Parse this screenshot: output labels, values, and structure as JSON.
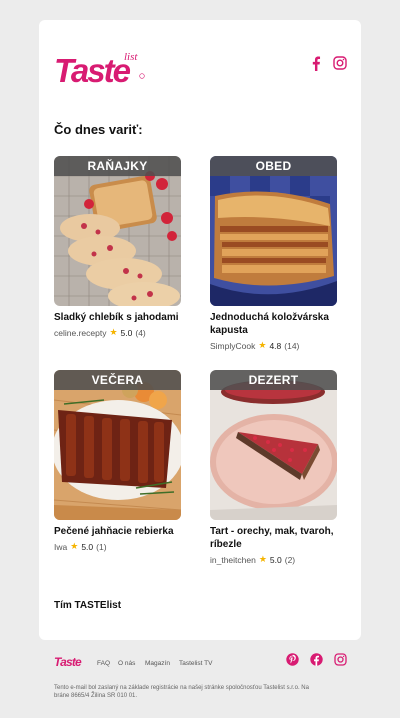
{
  "brand": {
    "name": "Taste",
    "suffix": "list",
    "color": "#d81b72"
  },
  "header": {
    "social": [
      "facebook-icon",
      "instagram-icon"
    ]
  },
  "main": {
    "heading": "Čo dnes variť:",
    "recipes": [
      {
        "category": "RAŇAJKY",
        "title": "Sladký chlebík s jahodami",
        "author": "celine.recepty",
        "rating": "5.0",
        "reviews": "(4)"
      },
      {
        "category": "OBED",
        "title": "Jednoduchá koložvárska kapusta",
        "author": "SimplyCook",
        "rating": "4.8",
        "reviews": "(14)"
      },
      {
        "category": "VEČERA",
        "title": "Pečené jahňacie rebierka",
        "author": "Iwa",
        "rating": "5.0",
        "reviews": "(1)"
      },
      {
        "category": "DEZERT",
        "title": "Tart - orechy, mak, tvaroh, ríbezle",
        "author": "in_theitchen",
        "rating": "5.0",
        "reviews": "(2)"
      }
    ],
    "signoff": "Tím TASTElist"
  },
  "footer": {
    "links": [
      "FAQ",
      "O nás",
      "Magazín",
      "Tastelist TV"
    ],
    "social": [
      "pinterest-icon",
      "facebook-icon",
      "instagram-icon"
    ],
    "legal": "Tento e-mail bol zaslaný na základe registrácie na našej stránke spoločnosťou Tastelist s.r.o. Na bráne 8665/4 Žilina SR 010 01."
  }
}
